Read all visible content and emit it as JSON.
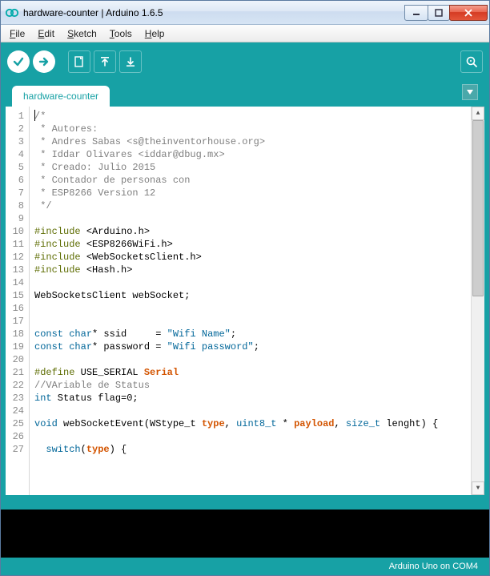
{
  "window": {
    "title": "hardware-counter | Arduino 1.6.5"
  },
  "menu": {
    "file": "File",
    "edit": "Edit",
    "sketch": "Sketch",
    "tools": "Tools",
    "help": "Help"
  },
  "tabs": {
    "active": "hardware-counter"
  },
  "status": {
    "board": "Arduino Uno on COM4"
  },
  "code": {
    "lines": [
      {
        "n": "1",
        "tokens": [
          {
            "t": "/*",
            "c": "c-comment"
          }
        ]
      },
      {
        "n": "2",
        "tokens": [
          {
            "t": " * Autores:",
            "c": "c-comment"
          }
        ]
      },
      {
        "n": "3",
        "tokens": [
          {
            "t": " * Andres Sabas <s@theinventorhouse.org>",
            "c": "c-comment"
          }
        ]
      },
      {
        "n": "4",
        "tokens": [
          {
            "t": " * Iddar Olivares <iddar@dbug.mx>",
            "c": "c-comment"
          }
        ]
      },
      {
        "n": "5",
        "tokens": [
          {
            "t": " * Creado: Julio 2015",
            "c": "c-comment"
          }
        ]
      },
      {
        "n": "6",
        "tokens": [
          {
            "t": " * Contador de personas con",
            "c": "c-comment"
          }
        ]
      },
      {
        "n": "7",
        "tokens": [
          {
            "t": " * ESP8266 Version 12",
            "c": "c-comment"
          }
        ]
      },
      {
        "n": "8",
        "tokens": [
          {
            "t": " */",
            "c": "c-comment"
          }
        ]
      },
      {
        "n": "9",
        "tokens": []
      },
      {
        "n": "10",
        "tokens": [
          {
            "t": "#include ",
            "c": "c-preproc"
          },
          {
            "t": "<Arduino.h>",
            "c": "c-ident"
          }
        ]
      },
      {
        "n": "11",
        "tokens": [
          {
            "t": "#include ",
            "c": "c-preproc"
          },
          {
            "t": "<ESP8266WiFi.h>",
            "c": "c-ident"
          }
        ]
      },
      {
        "n": "12",
        "tokens": [
          {
            "t": "#include ",
            "c": "c-preproc"
          },
          {
            "t": "<WebSocketsClient.h>",
            "c": "c-ident"
          }
        ]
      },
      {
        "n": "13",
        "tokens": [
          {
            "t": "#include ",
            "c": "c-preproc"
          },
          {
            "t": "<Hash.h>",
            "c": "c-ident"
          }
        ]
      },
      {
        "n": "14",
        "tokens": []
      },
      {
        "n": "15",
        "tokens": [
          {
            "t": "WebSocketsClient webSocket;",
            "c": "c-ident"
          }
        ]
      },
      {
        "n": "16",
        "tokens": []
      },
      {
        "n": "17",
        "tokens": []
      },
      {
        "n": "18",
        "tokens": [
          {
            "t": "const",
            "c": "c-keyword"
          },
          {
            "t": " ",
            "c": ""
          },
          {
            "t": "char",
            "c": "c-keyword"
          },
          {
            "t": "* ssid     = ",
            "c": "c-ident"
          },
          {
            "t": "\"Wifi Name\"",
            "c": "c-string"
          },
          {
            "t": ";",
            "c": "c-ident"
          }
        ]
      },
      {
        "n": "19",
        "tokens": [
          {
            "t": "const",
            "c": "c-keyword"
          },
          {
            "t": " ",
            "c": ""
          },
          {
            "t": "char",
            "c": "c-keyword"
          },
          {
            "t": "* password = ",
            "c": "c-ident"
          },
          {
            "t": "\"Wifi password\"",
            "c": "c-string"
          },
          {
            "t": ";",
            "c": "c-ident"
          }
        ]
      },
      {
        "n": "20",
        "tokens": []
      },
      {
        "n": "21",
        "tokens": [
          {
            "t": "#define",
            "c": "c-preproc"
          },
          {
            "t": " USE_SERIAL ",
            "c": "c-ident"
          },
          {
            "t": "Serial",
            "c": "c-serial"
          }
        ]
      },
      {
        "n": "22",
        "tokens": [
          {
            "t": "//VAriable de Status",
            "c": "c-comment"
          }
        ]
      },
      {
        "n": "23",
        "tokens": [
          {
            "t": "int",
            "c": "c-keyword"
          },
          {
            "t": " Status flag=0;",
            "c": "c-ident"
          }
        ]
      },
      {
        "n": "24",
        "tokens": []
      },
      {
        "n": "25",
        "tokens": [
          {
            "t": "void",
            "c": "c-keyword"
          },
          {
            "t": " webSocketEvent(WStype_t ",
            "c": "c-ident"
          },
          {
            "t": "type",
            "c": "c-type"
          },
          {
            "t": ", ",
            "c": "c-ident"
          },
          {
            "t": "uint8_t",
            "c": "c-keyword"
          },
          {
            "t": " * ",
            "c": "c-ident"
          },
          {
            "t": "payload",
            "c": "c-type"
          },
          {
            "t": ", ",
            "c": "c-ident"
          },
          {
            "t": "size_t",
            "c": "c-keyword"
          },
          {
            "t": " lenght) {",
            "c": "c-ident"
          }
        ]
      },
      {
        "n": "26",
        "tokens": []
      },
      {
        "n": "27",
        "tokens": [
          {
            "t": "  ",
            "c": ""
          },
          {
            "t": "switch",
            "c": "c-keyword"
          },
          {
            "t": "(",
            "c": "c-ident"
          },
          {
            "t": "type",
            "c": "c-type"
          },
          {
            "t": ") {",
            "c": "c-ident"
          }
        ]
      }
    ]
  }
}
